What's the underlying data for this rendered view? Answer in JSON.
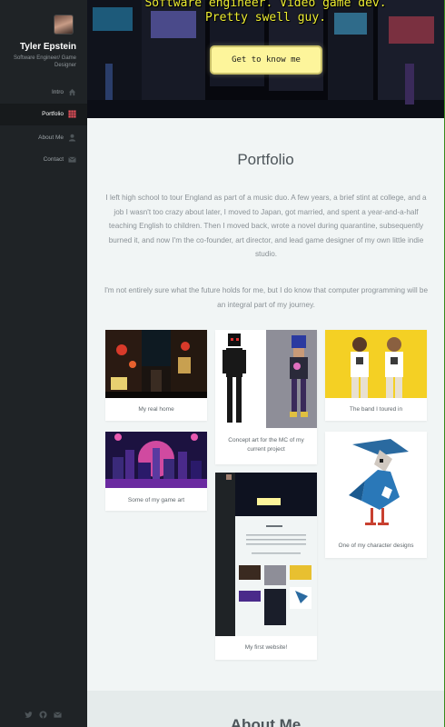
{
  "sidebar": {
    "name": "Tyler Epstein",
    "role": "Software Engineer/ Game Designer",
    "nav": [
      {
        "label": "Intro",
        "icon": "home-icon"
      },
      {
        "label": "Portfolio",
        "icon": "grid-icon"
      },
      {
        "label": "About Me",
        "icon": "user-icon"
      },
      {
        "label": "Contact",
        "icon": "envelope-icon"
      }
    ],
    "social": [
      "twitter-icon",
      "github-icon",
      "email-icon"
    ]
  },
  "header": {
    "line1": "Software engineer. Video game dev.",
    "line2": "Pretty swell guy.",
    "cta": "Get to know me"
  },
  "portfolio": {
    "title": "Portfolio",
    "paragraph1": "I left high school to tour England as part of a music duo. A few years, a brief stint at college, and a job I wasn't too crazy about later, I moved to Japan, got married, and spent a year-and-a-half teaching English to children. Then I moved back, wrote a novel during quarantine, subsequently burned it, and now I'm the co-founder, art director, and lead game designer of my own little indie studio.",
    "paragraph2": "I'm not entirely sure what the future holds for me, but I do know that computer programming will be an integral part of my journey.",
    "cards": [
      {
        "caption": "My real home"
      },
      {
        "caption": "Some of my game art"
      },
      {
        "caption": "Concept art for the MC of my current project"
      },
      {
        "caption": "My first website!"
      },
      {
        "caption": "The band I toured in"
      },
      {
        "caption": "One of my character designs"
      }
    ]
  },
  "about": {
    "title": "About Me"
  },
  "colors": {
    "sidebar_bg": "#1f2326",
    "accent": "#e8505b",
    "cta_bg": "#fdf59b",
    "header_text": "#ecec32"
  }
}
